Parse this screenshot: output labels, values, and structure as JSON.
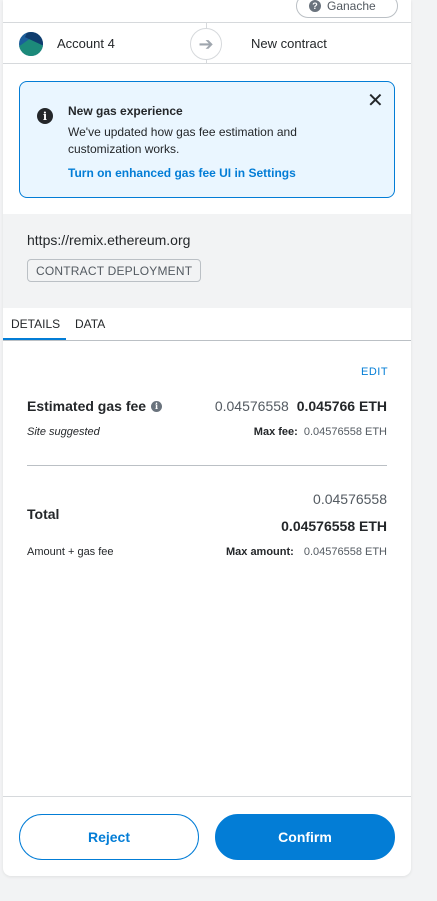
{
  "header": {
    "network_label": "Ganache",
    "network_icon": "question-icon"
  },
  "account_row": {
    "account_name": "Account 4",
    "recipient": "New contract"
  },
  "banner": {
    "title": "New gas experience",
    "body": "We've updated how gas fee estimation and customization works.",
    "link": "Turn on enhanced gas fee UI in Settings",
    "close_glyph": "✕"
  },
  "origin": {
    "url": "https://remix.ethereum.org",
    "badge": "CONTRACT DEPLOYMENT"
  },
  "tabs": [
    {
      "label": "DETAILS",
      "active": true
    },
    {
      "label": "DATA",
      "active": false
    }
  ],
  "details": {
    "edit_label": "EDIT",
    "gas_fee_label": "Estimated gas fee",
    "gas_fee_secondary": "0.04576558",
    "gas_fee_primary": "0.045766 ETH",
    "site_suggested": "Site suggested",
    "max_fee_label": "Max fee:",
    "max_fee_value": "0.04576558 ETH",
    "total_label": "Total",
    "total_secondary": "0.04576558",
    "total_primary": "0.04576558 ETH",
    "amount_gas_label": "Amount + gas fee",
    "max_amount_label": "Max amount:",
    "max_amount_value": "0.04576558 ETH"
  },
  "footer": {
    "reject_label": "Reject",
    "confirm_label": "Confirm"
  },
  "colors": {
    "accent": "#037dd6",
    "banner_bg": "#eaf6ff",
    "section_bg": "#f2f3f4"
  }
}
